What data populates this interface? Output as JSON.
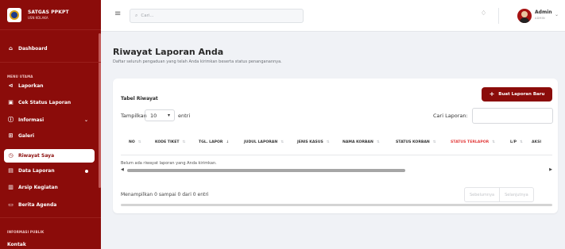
{
  "brand": {
    "title": "SATGAS PPKPT",
    "subtitle": "USN KOLAKA"
  },
  "sidebar": {
    "dashboard": "Dashboard",
    "section_main": "MENU UTAMA",
    "items": [
      {
        "label": "Laporkan",
        "icon": "megaphone-icon"
      },
      {
        "label": "Cek Status Laporan",
        "icon": "clipboard-icon"
      },
      {
        "label": "Informasi",
        "icon": "info-icon"
      },
      {
        "label": "Galeri",
        "icon": "gallery-icon"
      },
      {
        "label": "Riwayat Saya",
        "icon": "history-icon"
      },
      {
        "label": "Data Laporan",
        "icon": "document-icon"
      },
      {
        "label": "Arsip Kegiatan",
        "icon": "archive-icon"
      },
      {
        "label": "Berita Agenda",
        "icon": "news-icon"
      }
    ],
    "section_public": "INFORMASI PUBLIK",
    "public_items": [
      {
        "label": "Kontak"
      }
    ]
  },
  "topbar": {
    "search_placeholder": "Cari...",
    "user": {
      "name": "Admin",
      "role": "ADMIN"
    }
  },
  "page": {
    "title": "Riwayat Laporan Anda",
    "subtitle": "Daftar seluruh pengaduan yang telah Anda kirimkan beserta status penanganannya."
  },
  "card": {
    "title": "Tabel Riwayat",
    "new_button": "Buat Laporan Baru",
    "show_label": "Tampilkan",
    "entries_value": "10",
    "entries_label": "entri",
    "search_label": "Cari Laporan:",
    "columns": [
      "NO",
      "KODE TIKET",
      "TGL. LAPOR",
      "JUDUL LAPORAN",
      "JENIS KASUS",
      "NAMA KORBAN",
      "STATUS KORBAN",
      "STATUS TERLAPOR",
      "L/P",
      "AKSI"
    ],
    "empty_message": "Belum ada riwayat laporan yang Anda kirimkan.",
    "info": "Menampilkan 0 sampai 0 dari 0 entri",
    "prev": "Sebelumnya",
    "next": "Selanjutnya"
  },
  "colors": {
    "primary": "#8b0c0a",
    "highlight": "#e23a3a"
  }
}
